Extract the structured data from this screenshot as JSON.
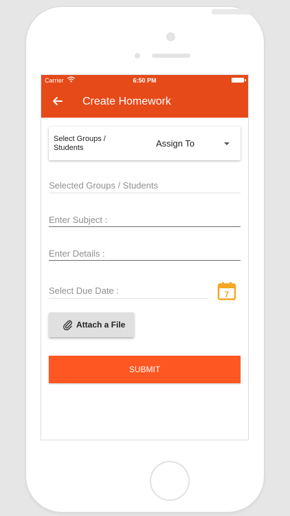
{
  "status_bar": {
    "carrier": "Carrier",
    "time": "6:50 PM"
  },
  "app_bar": {
    "title": "Create Homework",
    "back_icon": "arrow-left-icon"
  },
  "assign": {
    "label": "Select Groups / Students",
    "value": "Assign To",
    "icon": "dropdown-arrow-icon"
  },
  "fields": {
    "groups": "Selected Groups / Students",
    "subject": "Enter Subject :",
    "details": "Enter Details :",
    "due_date": "Select Due Date :"
  },
  "calendar": {
    "icon": "calendar-icon",
    "day": "7"
  },
  "attach": {
    "label": "Attach a File",
    "icon": "paperclip-icon"
  },
  "submit": {
    "label": "SUBMIT"
  },
  "colors": {
    "app_bar": "#e64a19",
    "submit": "#ff5722",
    "calendar": "#f5a623",
    "attach_button": "#e0e0e0"
  }
}
